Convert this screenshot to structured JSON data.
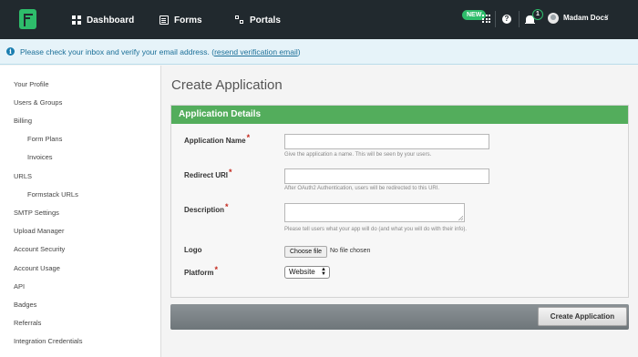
{
  "nav": {
    "links": [
      {
        "label": "Dashboard",
        "icon": "dashboard-icon"
      },
      {
        "label": "Forms",
        "icon": "forms-icon"
      },
      {
        "label": "Portals",
        "icon": "portals-icon"
      }
    ],
    "new_badge": "NEW",
    "notification_count": "1",
    "user_name": "Madam Docs",
    "user_menu_chevron": "v"
  },
  "notice": {
    "text": "Please check your inbox and verify your email address. (",
    "link": "resend verification email",
    "text_end": ")"
  },
  "sidebar": {
    "items": [
      {
        "label": "Your Profile"
      },
      {
        "label": "Users & Groups"
      },
      {
        "label": "Billing"
      },
      {
        "label": "Form Plans"
      },
      {
        "label": "Invoices"
      },
      {
        "label": "URLS"
      },
      {
        "label": "Formstack URLs"
      },
      {
        "label": "SMTP Settings"
      },
      {
        "label": "Upload Manager"
      },
      {
        "label": "Account Security"
      },
      {
        "label": "Account Usage"
      },
      {
        "label": "API"
      },
      {
        "label": "Badges"
      },
      {
        "label": "Referrals"
      },
      {
        "label": "Integration Credentials"
      }
    ]
  },
  "page": {
    "title": "Create Application",
    "panel_title": "Application Details",
    "required_mark": "*",
    "fields": {
      "name": {
        "label": "Application Name",
        "value": "",
        "hint": "Give the application a name. This will be seen by your users."
      },
      "redirect": {
        "label": "Redirect URI",
        "value": "",
        "hint": "After OAuth2 Authentication, users will be redirected to this URI."
      },
      "description": {
        "label": "Description",
        "value": "",
        "hint": "Please tell users what your app will do (and what you will do with their info)."
      },
      "logo": {
        "label": "Logo",
        "button": "Choose file",
        "status": "No file chosen"
      },
      "platform": {
        "label": "Platform",
        "selected": "Website"
      }
    },
    "submit_label": "Create Application"
  },
  "colors": {
    "nav_bg": "#21292e",
    "brand_green": "#2ebd6b",
    "panel_header": "#53ad5c",
    "notice_bg": "#e6f3f9",
    "required": "#c4271c"
  }
}
